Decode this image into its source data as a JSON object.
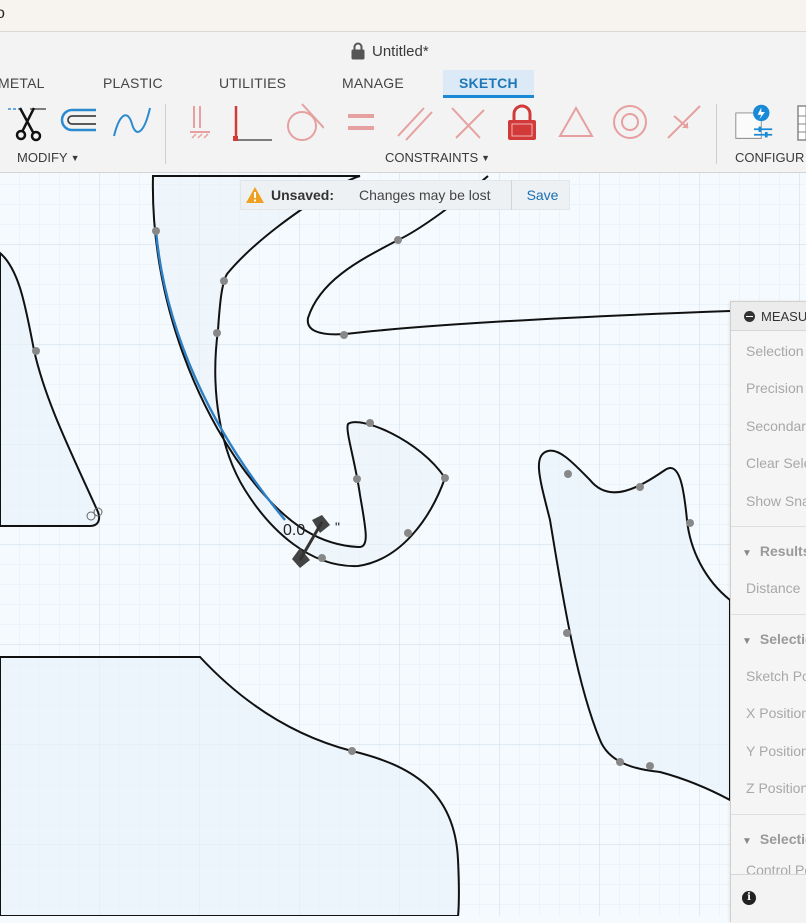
{
  "window": {
    "title": "Untitled*"
  },
  "tabs": [
    {
      "label": "METAL"
    },
    {
      "label": "PLASTIC"
    },
    {
      "label": "UTILITIES"
    },
    {
      "label": "MANAGE"
    },
    {
      "label": "SKETCH",
      "active": true
    }
  ],
  "toolbar": {
    "groups": {
      "modify": "MODIFY",
      "constraints": "CONSTRAINTS",
      "configure": "CONFIGUR"
    }
  },
  "notification": {
    "label": "Unsaved:",
    "message": "Changes may be lost",
    "action": "Save"
  },
  "canvas": {
    "dimension_label": "0.0",
    "dimension_suffix": "\""
  },
  "measure_panel": {
    "title": "MEASU",
    "rows": {
      "selection": "Selection",
      "precision": "Precision",
      "secondary": "Secondary",
      "clear_selection": "Clear Sele",
      "show_snap": "Show Snap",
      "distance": "Distance",
      "sketch_point": "Sketch Po",
      "x_position": "X Position",
      "y_position": "Y Position",
      "z_position": "Z Position",
      "control_points": "Control Po"
    },
    "sections": {
      "results": "Results",
      "selection_1": "Selectio",
      "selection_2": "Selectio"
    }
  },
  "colors": {
    "accent": "#1a8ad6",
    "constraint_red": "#e05a5a",
    "warning": "#f0a020",
    "canvas_bg": "#f4fafe"
  }
}
